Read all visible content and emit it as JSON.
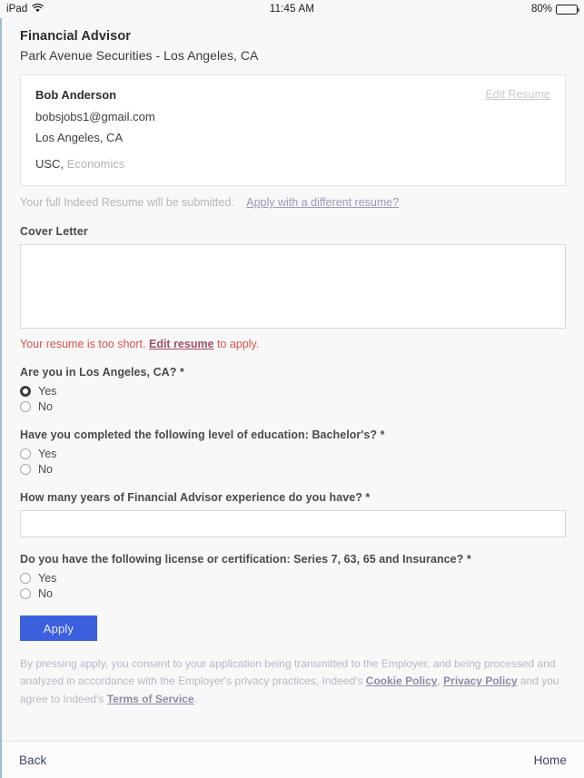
{
  "status_bar": {
    "device": "iPad",
    "wifi_icon": "wifi-icon",
    "time": "11:45 AM",
    "battery_percent": "80%",
    "battery_level": 80
  },
  "job": {
    "title": "Financial Advisor",
    "company_location": "Park Avenue Securities - Los Angeles, CA"
  },
  "resume_card": {
    "name": "Bob Anderson",
    "email": "bobsjobs1@gmail.com",
    "location": "Los Angeles, CA",
    "school": "USC,",
    "major": "Economics",
    "edit_link": "Edit Resume"
  },
  "resume_note": {
    "text": "Your full Indeed Resume will be submitted.",
    "link": "Apply with a different resume?"
  },
  "cover_letter": {
    "label": "Cover Letter",
    "value": "",
    "placeholder": ""
  },
  "error": {
    "prefix": "Your resume is too short.",
    "link": "Edit resume",
    "suffix": "to apply."
  },
  "questions": [
    {
      "label": "Are you in Los Angeles, CA? *",
      "type": "radio",
      "options": [
        {
          "label": "Yes",
          "selected": true
        },
        {
          "label": "No",
          "selected": false
        }
      ]
    },
    {
      "label": "Have you completed the following level of education: Bachelor's? *",
      "type": "radio",
      "options": [
        {
          "label": "Yes",
          "selected": false
        },
        {
          "label": "No",
          "selected": false
        }
      ]
    },
    {
      "label": "How many years of Financial Advisor experience do you have? *",
      "type": "text",
      "value": "",
      "placeholder": ""
    },
    {
      "label": "Do you have the following license or certification: Series 7, 63, 65 and Insurance? *",
      "type": "radio",
      "options": [
        {
          "label": "Yes",
          "selected": false
        },
        {
          "label": "No",
          "selected": false
        }
      ]
    }
  ],
  "apply_button": {
    "label": "Apply",
    "color": "#3c5fdd"
  },
  "disclaimer": {
    "part1": "By pressing apply, you consent to your application being transmitted to the Employer, and being processed and analyzed in accordance with the Employer's privacy practices, Indeed's ",
    "link1": "Cookie Policy",
    "part2": ", ",
    "link2": "Privacy Policy",
    "part3": " and you agree to Indeed's ",
    "link3": "Terms of Service",
    "part4": "."
  },
  "bottom_bar": {
    "back": "Back",
    "home": "Home"
  }
}
